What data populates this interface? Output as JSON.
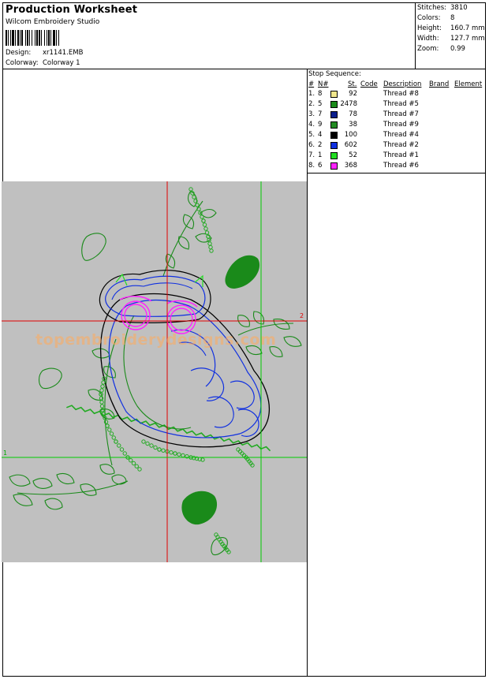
{
  "header": {
    "title": "Production Worksheet",
    "software": "Wilcom  Embroidery Studio",
    "design_label": "Design:",
    "design_value": "xr1141.EMB",
    "colorway_label": "Colorway:",
    "colorway_value": "Colorway 1"
  },
  "stats": [
    {
      "label": "Stitches:",
      "value": "3810"
    },
    {
      "label": "Colors:",
      "value": "8"
    },
    {
      "label": "Height:",
      "value": "160.7 mm"
    },
    {
      "label": "Width:",
      "value": "127.7 mm"
    },
    {
      "label": "Zoom:",
      "value": "0.99"
    }
  ],
  "stop_sequence": {
    "title": "Stop Sequence:",
    "columns": [
      "#",
      "N#",
      "St.",
      "Code",
      "Description",
      "Brand",
      "Element"
    ],
    "rows": [
      {
        "num": "1.",
        "n": "8",
        "st": "92",
        "desc": "Thread #8",
        "color": "#f0e68c"
      },
      {
        "num": "2.",
        "n": "5",
        "st": "2478",
        "desc": "Thread #5",
        "color": "#1a8a1a"
      },
      {
        "num": "3.",
        "n": "7",
        "st": "78",
        "desc": "Thread #7",
        "color": "#0a1e8c"
      },
      {
        "num": "4.",
        "n": "9",
        "st": "38",
        "desc": "Thread #9",
        "color": "#228b22"
      },
      {
        "num": "5.",
        "n": "4",
        "st": "100",
        "desc": "Thread #4",
        "color": "#000000"
      },
      {
        "num": "6.",
        "n": "2",
        "st": "602",
        "desc": "Thread #2",
        "color": "#1030e0"
      },
      {
        "num": "7.",
        "n": "1",
        "st": "52",
        "desc": "Thread #1",
        "color": "#22dd22"
      },
      {
        "num": "8.",
        "n": "6",
        "st": "368",
        "desc": "Thread #6",
        "color": "#ff22ff"
      }
    ]
  },
  "design": {
    "watermark": "topembroiderydesigns.com",
    "marker_1": "1",
    "marker_2": "2",
    "background_color": "#c0c0c0",
    "guide_red": "#e00000",
    "guide_green": "#00cc00"
  }
}
